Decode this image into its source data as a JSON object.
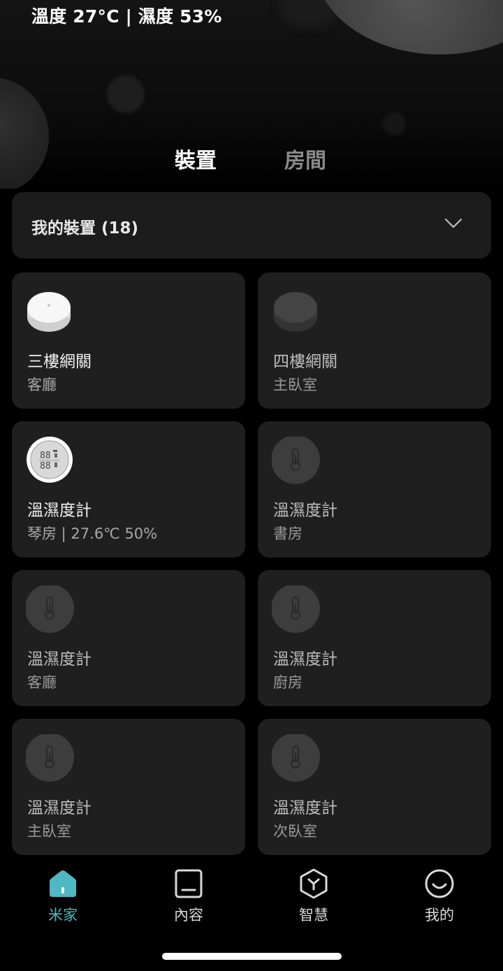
{
  "status": {
    "weather": "溫度 27°C | 濕度 53%"
  },
  "tabs": [
    {
      "label": "裝置",
      "active": true
    },
    {
      "label": "房間",
      "active": false
    }
  ],
  "device_group": {
    "title": "我的裝置 (18)"
  },
  "devices": [
    {
      "name": "三樓網關",
      "room": "客廳",
      "icon": "gateway-white-icon",
      "online": true
    },
    {
      "name": "四樓網關",
      "room": "主臥室",
      "icon": "gateway-dark-icon",
      "online": false
    },
    {
      "name": "溫濕度計",
      "room": "琴房 | 27.6℃ 50%",
      "icon": "thermo-hygrometer-icon",
      "online": true
    },
    {
      "name": "溫濕度計",
      "room": "書房",
      "icon": "thermometer-icon",
      "online": false
    },
    {
      "name": "溫濕度計",
      "room": "客廳",
      "icon": "thermometer-icon",
      "online": false
    },
    {
      "name": "溫濕度計",
      "room": "廚房",
      "icon": "thermometer-icon",
      "online": false
    },
    {
      "name": "溫濕度計",
      "room": "主臥室",
      "icon": "thermometer-icon",
      "online": false
    },
    {
      "name": "溫濕度計",
      "room": "次臥室",
      "icon": "thermometer-icon",
      "online": false
    }
  ],
  "nav": [
    {
      "label": "米家",
      "icon": "home-icon",
      "active": true
    },
    {
      "label": "內容",
      "icon": "content-icon",
      "active": false
    },
    {
      "label": "智慧",
      "icon": "smart-icon",
      "active": false
    },
    {
      "label": "我的",
      "icon": "profile-icon",
      "active": false
    }
  ],
  "colors": {
    "accent": "#4fb8c2",
    "card": "#1f1f1f",
    "background": "#000000"
  }
}
